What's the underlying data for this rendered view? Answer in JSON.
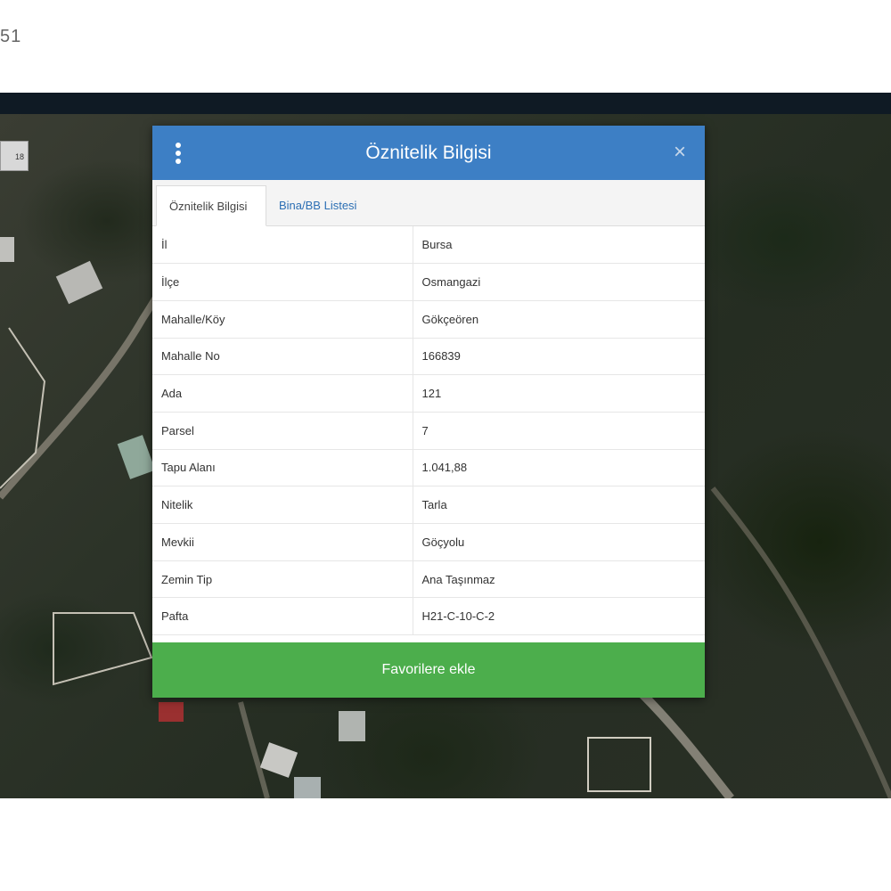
{
  "corner_text": "51",
  "map": {
    "corner_button_label": "18"
  },
  "dialog": {
    "title": "Öznitelik Bilgisi",
    "close_glyph": "×",
    "tabs": [
      {
        "label": "Öznitelik Bilgisi",
        "active": true
      },
      {
        "label": "Bina/BB Listesi",
        "active": false
      }
    ],
    "rows": [
      {
        "key": "İl",
        "value": "Bursa"
      },
      {
        "key": "İlçe",
        "value": "Osmangazi"
      },
      {
        "key": "Mahalle/Köy",
        "value": "Gökçeören"
      },
      {
        "key": "Mahalle No",
        "value": "166839"
      },
      {
        "key": "Ada",
        "value": "121"
      },
      {
        "key": "Parsel",
        "value": "7"
      },
      {
        "key": "Tapu Alanı",
        "value": "1.041,88"
      },
      {
        "key": "Nitelik",
        "value": "Tarla"
      },
      {
        "key": "Mevkii",
        "value": "Göçyolu"
      },
      {
        "key": "Zemin Tip",
        "value": "Ana Taşınmaz"
      },
      {
        "key": "Pafta",
        "value": "H21-C-10-C-2"
      }
    ],
    "favorite_button_label": "Favorilere ekle"
  },
  "colors": {
    "header_blue": "#3d7fc5",
    "button_green": "#4cae4c",
    "link_blue": "#2c6fb4"
  },
  "icons": {
    "menu": "grip-vertical-icon",
    "close": "close-icon"
  }
}
